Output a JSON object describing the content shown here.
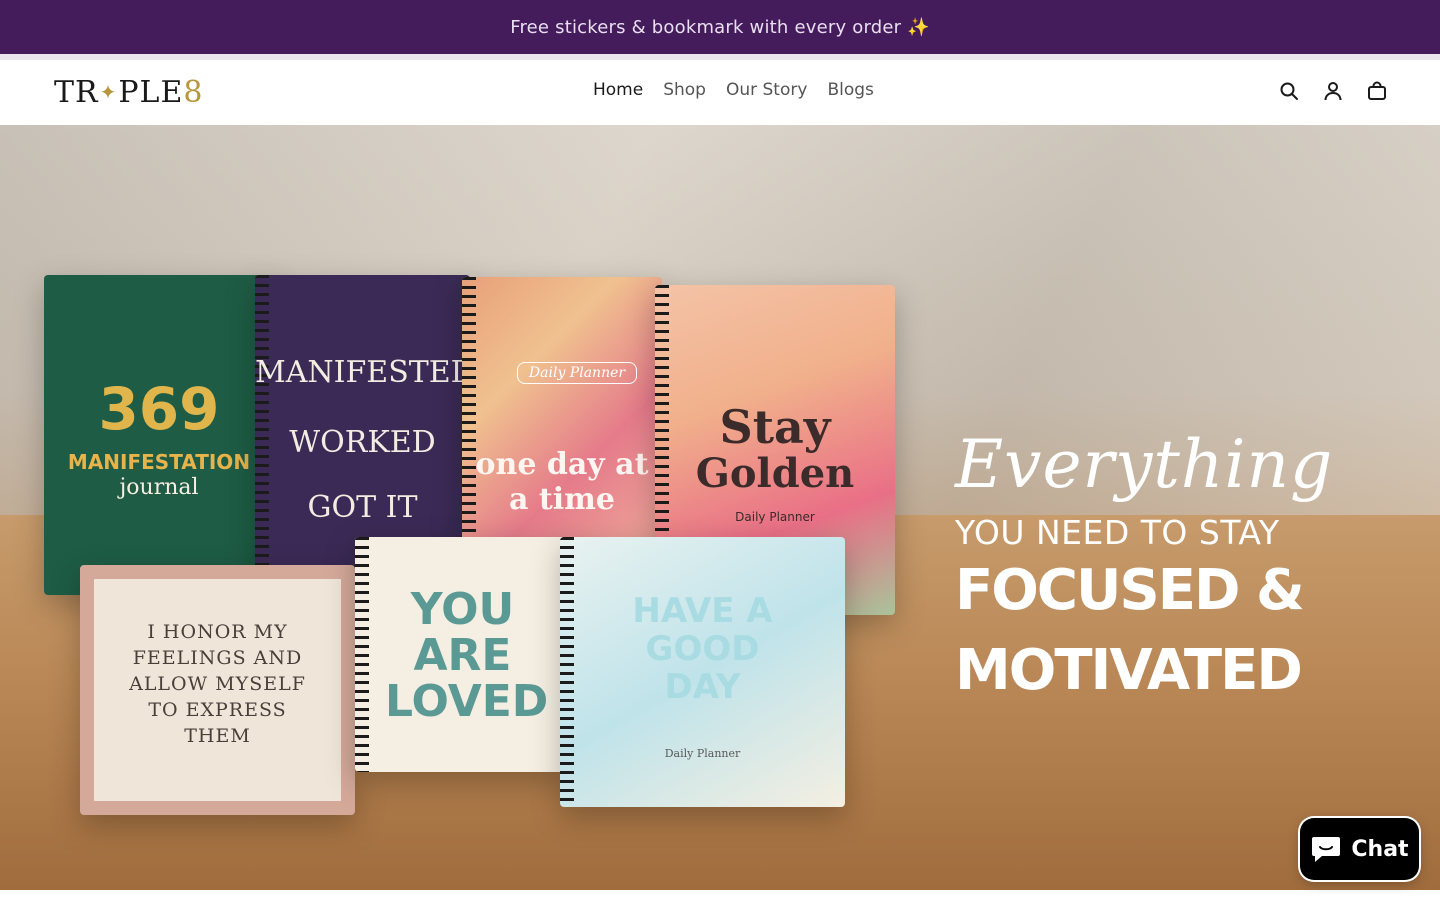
{
  "announcement": {
    "text": "Free stickers & bookmark with every order ✨"
  },
  "brand": {
    "logo_text_a": "TR",
    "logo_star": "✦",
    "logo_text_b": "PLE",
    "logo_eight": "8"
  },
  "nav": {
    "items": [
      {
        "label": "Home",
        "active": true
      },
      {
        "label": "Shop",
        "active": false
      },
      {
        "label": "Our Story",
        "active": false
      },
      {
        "label": "Blogs",
        "active": false
      }
    ]
  },
  "header_icons": [
    "search-icon",
    "account-icon",
    "cart-icon"
  ],
  "hero": {
    "headline_script": "Everything",
    "headline_mid": "YOU NEED TO STAY",
    "headline_big": "FOCUSED & MOTIVATED",
    "products": {
      "nb1": {
        "big": "369",
        "mid": "MANIFESTATION",
        "small": "journal"
      },
      "nb2": {
        "l1": "MANIFESTED",
        "l2": "WORKED",
        "l3": "GOT IT"
      },
      "nb3": {
        "tag": "Daily Planner",
        "sub": "one day at a time"
      },
      "nb4": {
        "l1": "Stay",
        "l2": "Golden",
        "l3": "Daily Planner"
      },
      "nb5": {
        "l": "I HONOR MY FEELINGS AND ALLOW MYSELF TO EXPRESS THEM"
      },
      "nb6": {
        "l": "YOU ARE LOVED"
      },
      "nb7": {
        "l": "HAVE A GOOD DAY",
        "s": "Daily Planner"
      }
    }
  },
  "chat": {
    "label": "Chat"
  },
  "colors": {
    "announcement_bg": "#441c5c",
    "accent_gold": "#b8963c",
    "chat_bg": "#000000"
  }
}
